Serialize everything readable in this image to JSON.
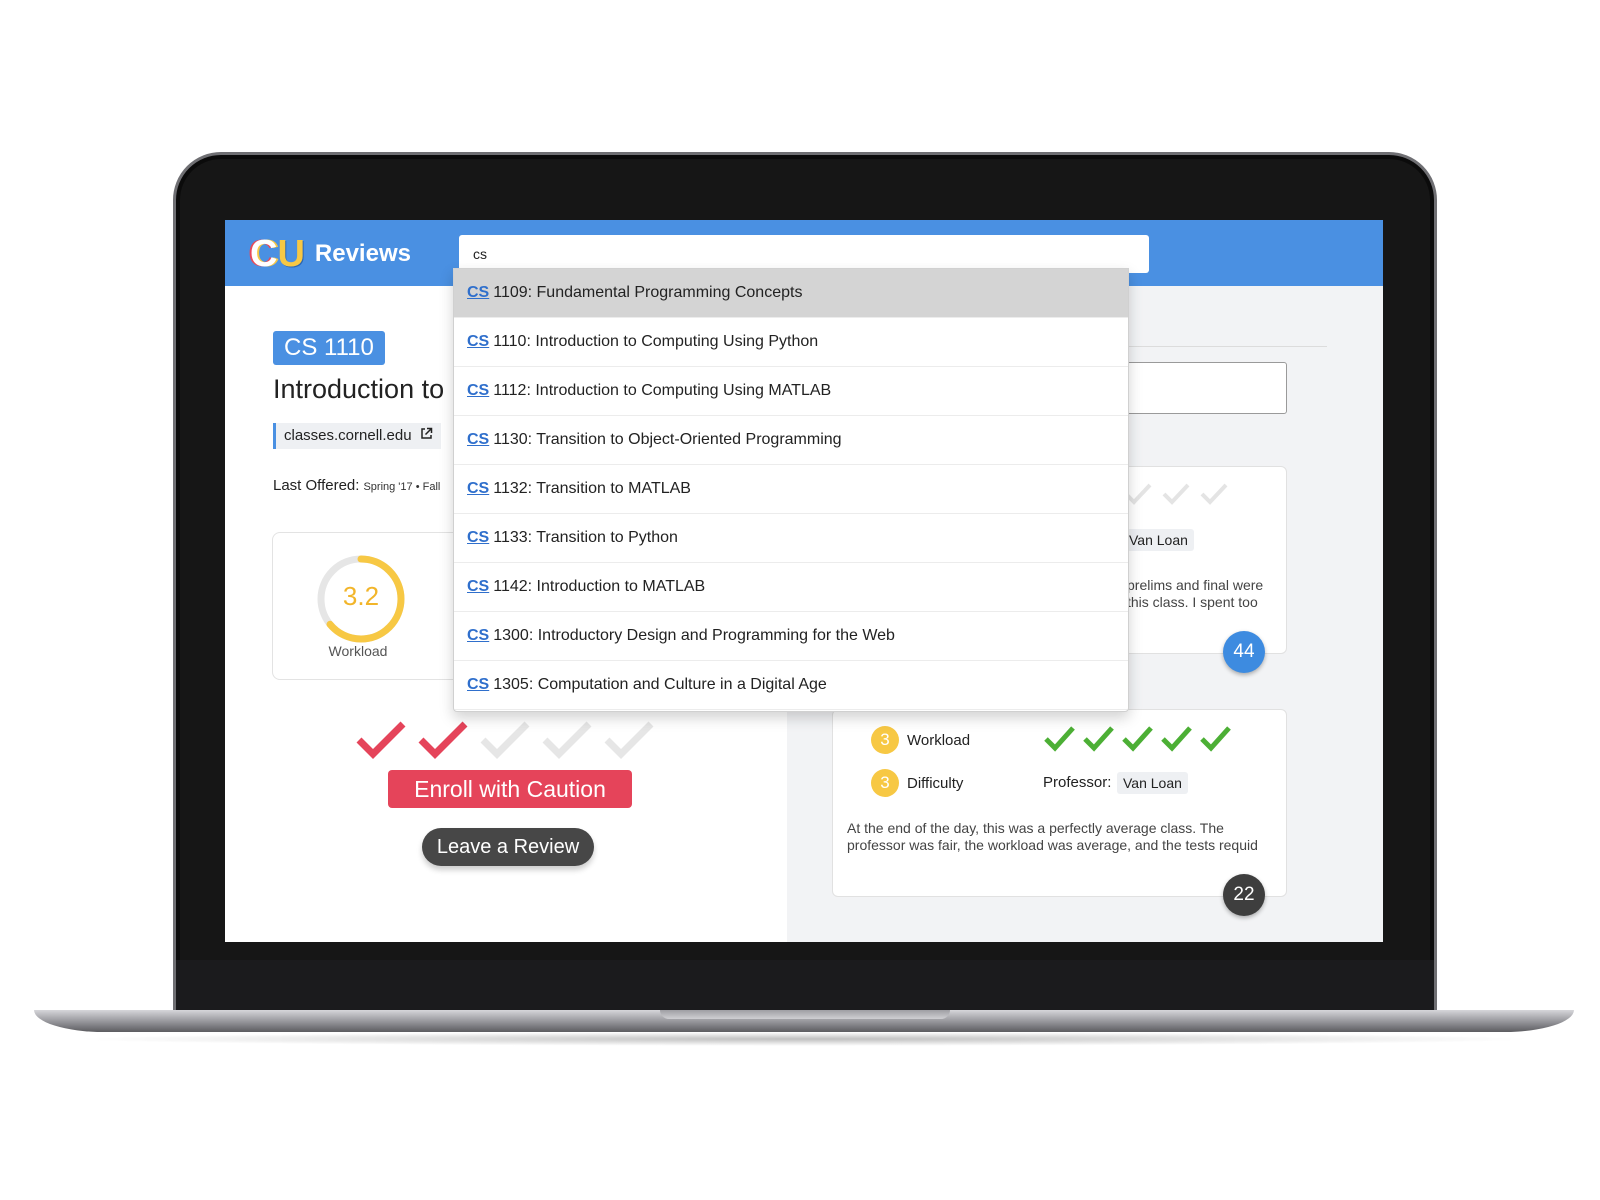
{
  "header": {
    "logo_c": "C",
    "logo_u": "U",
    "logo_text": "Reviews",
    "search_value": "cs"
  },
  "course": {
    "code": "CS 1110",
    "title_partial": "Introduction to",
    "link_text": "classes.cornell.edu",
    "last_offered_label": "Last Offered:",
    "last_offered_value": "Spring '17 • Fall"
  },
  "workload_gauge": {
    "value": "3.2",
    "label": "Workload",
    "fraction": 0.64
  },
  "recommendation": {
    "checks_filled": 2,
    "checks_total": 5,
    "caution_label": "Enroll with Caution",
    "review_label": "Leave a Review"
  },
  "reviews": [
    {
      "professor_partial": "Van Loan",
      "text_line1": "prelims and final were",
      "text_line2": "this class. I spent too",
      "votes": "44"
    },
    {
      "workload": "3",
      "workload_label": "Workload",
      "difficulty": "3",
      "difficulty_label": "Difficulty",
      "professor_label": "Professor:",
      "professor": "Van Loan",
      "text": "At the end of the day, this was a perfectly average class. The professor was fair, the workload was average, and the tests requid",
      "votes": "22",
      "checks": 5
    }
  ],
  "dropdown": {
    "match": "CS",
    "items": [
      "1109: Fundamental Programming Concepts",
      "1110: Introduction to Computing Using Python",
      "1112: Introduction to Computing Using MATLAB",
      "1130: Transition to Object-Oriented Programming",
      "1132: Transition to MATLAB",
      "1133: Transition to Python",
      "1142: Introduction to MATLAB",
      "1300: Introductory Design and Programming for the Web",
      "1305: Computation and Culture in a Digital Age"
    ]
  },
  "colors": {
    "brand_blue": "#4a90e2",
    "caution_red": "#e5445a",
    "gauge_yellow": "#f7c844",
    "check_green": "#4caf35"
  }
}
